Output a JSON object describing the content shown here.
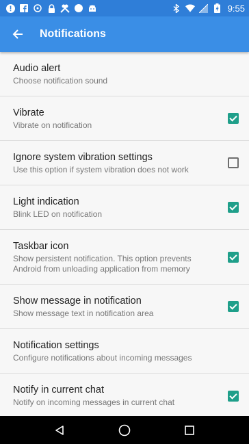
{
  "status_bar": {
    "time": "9:55",
    "left_icons": [
      "alert-icon",
      "facebook-icon",
      "sync-icon",
      "lock-icon",
      "tools-icon",
      "record-icon",
      "android-icon"
    ],
    "right_icons": [
      "bluetooth-icon",
      "wifi-icon",
      "signal-icon",
      "battery-icon"
    ]
  },
  "app_bar": {
    "title": "Notifications",
    "back_icon": "back-arrow-icon",
    "color": "#3a8ee6"
  },
  "settings": [
    {
      "id": "audio-alert",
      "title": "Audio alert",
      "summary": "Choose notification sound",
      "checkbox": null
    },
    {
      "id": "vibrate",
      "title": "Vibrate",
      "summary": "Vibrate on notification",
      "checkbox": true
    },
    {
      "id": "ignore-system-vibration",
      "title": "Ignore system vibration settings",
      "summary": "Use this option if system vibration does not work",
      "checkbox": false
    },
    {
      "id": "light-indication",
      "title": "Light indication",
      "summary": "Blink LED on notification",
      "checkbox": true
    },
    {
      "id": "taskbar-icon",
      "title": "Taskbar icon",
      "summary": "Show persistent notification. This option prevents Android from unloading application from memory",
      "checkbox": true
    },
    {
      "id": "show-message",
      "title": "Show message in notification",
      "summary": "Show message text in notification area",
      "checkbox": true
    },
    {
      "id": "notification-settings",
      "title": "Notification settings",
      "summary": "Configure notifications about incoming messages",
      "checkbox": null
    },
    {
      "id": "notify-current-chat",
      "title": "Notify in current chat",
      "summary": "Notify on incoming messages in current chat",
      "checkbox": true
    }
  ],
  "checkbox_color": "#1f9f8a",
  "nav_bar": {
    "buttons": [
      "back-triangle-icon",
      "home-circle-icon",
      "recents-square-icon"
    ]
  }
}
